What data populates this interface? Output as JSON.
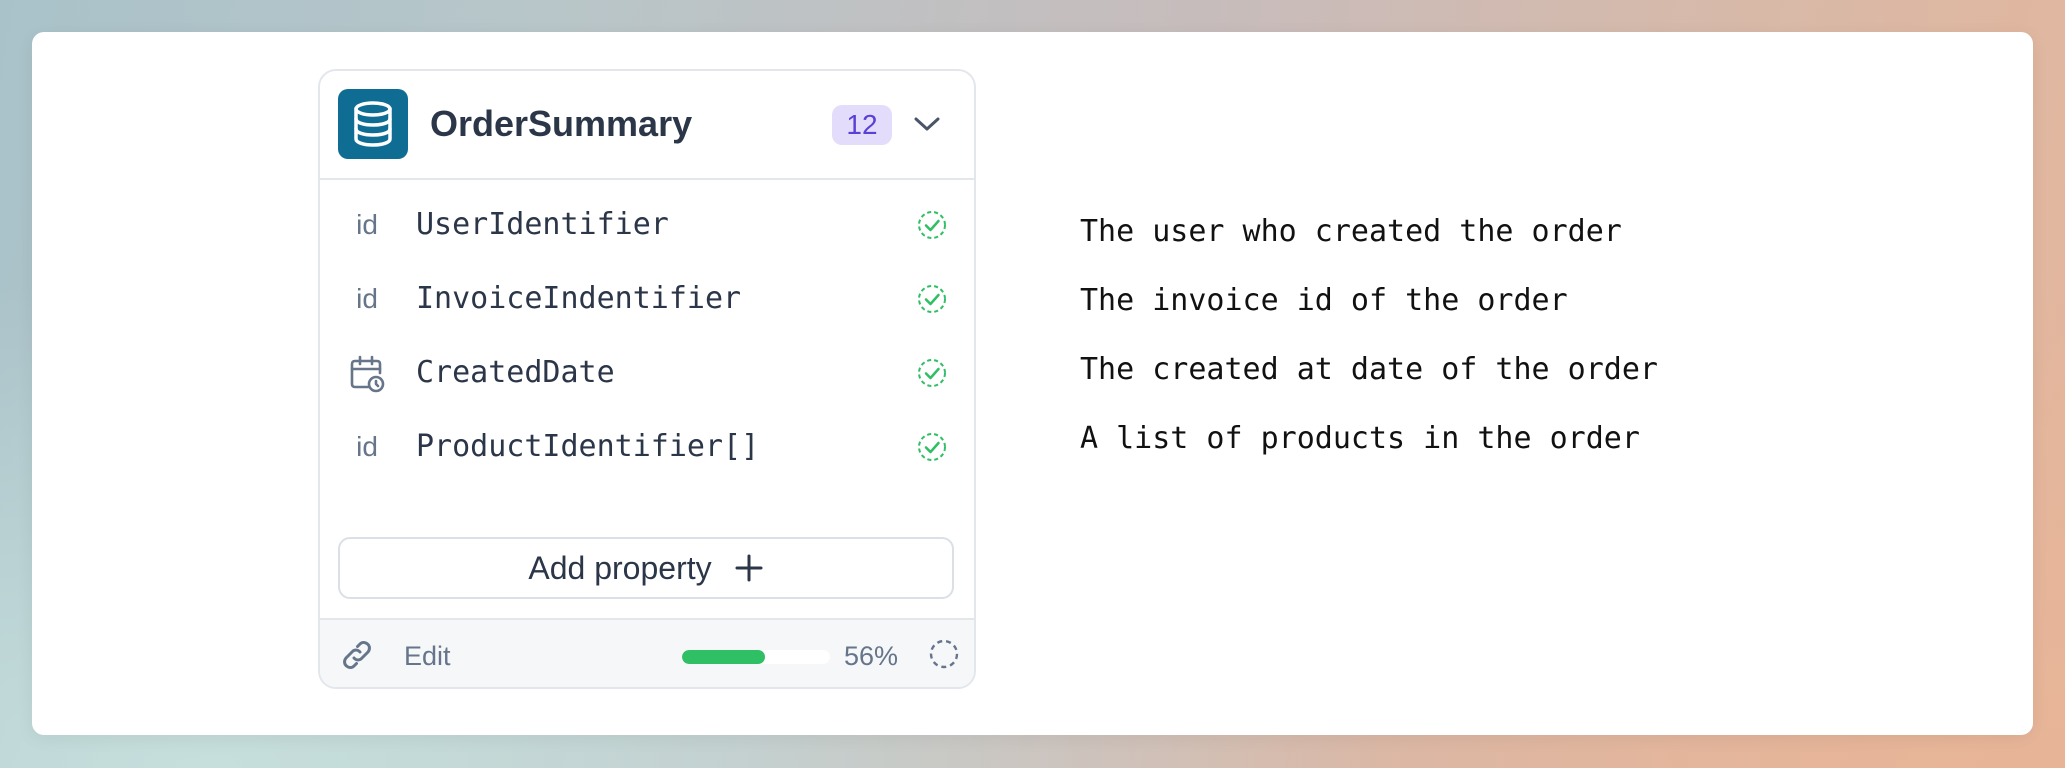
{
  "entity": {
    "title": "OrderSummary",
    "count": "12",
    "icon": "database-icon",
    "accent_color": "#0f6d94",
    "badge_color": "#e3ddfb"
  },
  "properties": [
    {
      "type_label": "id",
      "type_icon": null,
      "name": "UserIdentifier",
      "status": "verified",
      "description": "The user who created the order"
    },
    {
      "type_label": "id",
      "type_icon": null,
      "name": "InvoiceIndentifier",
      "status": "verified",
      "description": "The invoice id of the order"
    },
    {
      "type_label": "",
      "type_icon": "calendar-clock-icon",
      "name": "CreatedDate",
      "status": "verified",
      "description": "The created at date of the order"
    },
    {
      "type_label": "id",
      "type_icon": null,
      "name": "ProductIdentifier[]",
      "status": "verified",
      "description": "A list of products in the order"
    }
  ],
  "add_property_label": "Add property",
  "footer": {
    "edit_label": "Edit",
    "progress": 0.56,
    "progress_label": "56%",
    "progress_color": "#2fbf64"
  }
}
